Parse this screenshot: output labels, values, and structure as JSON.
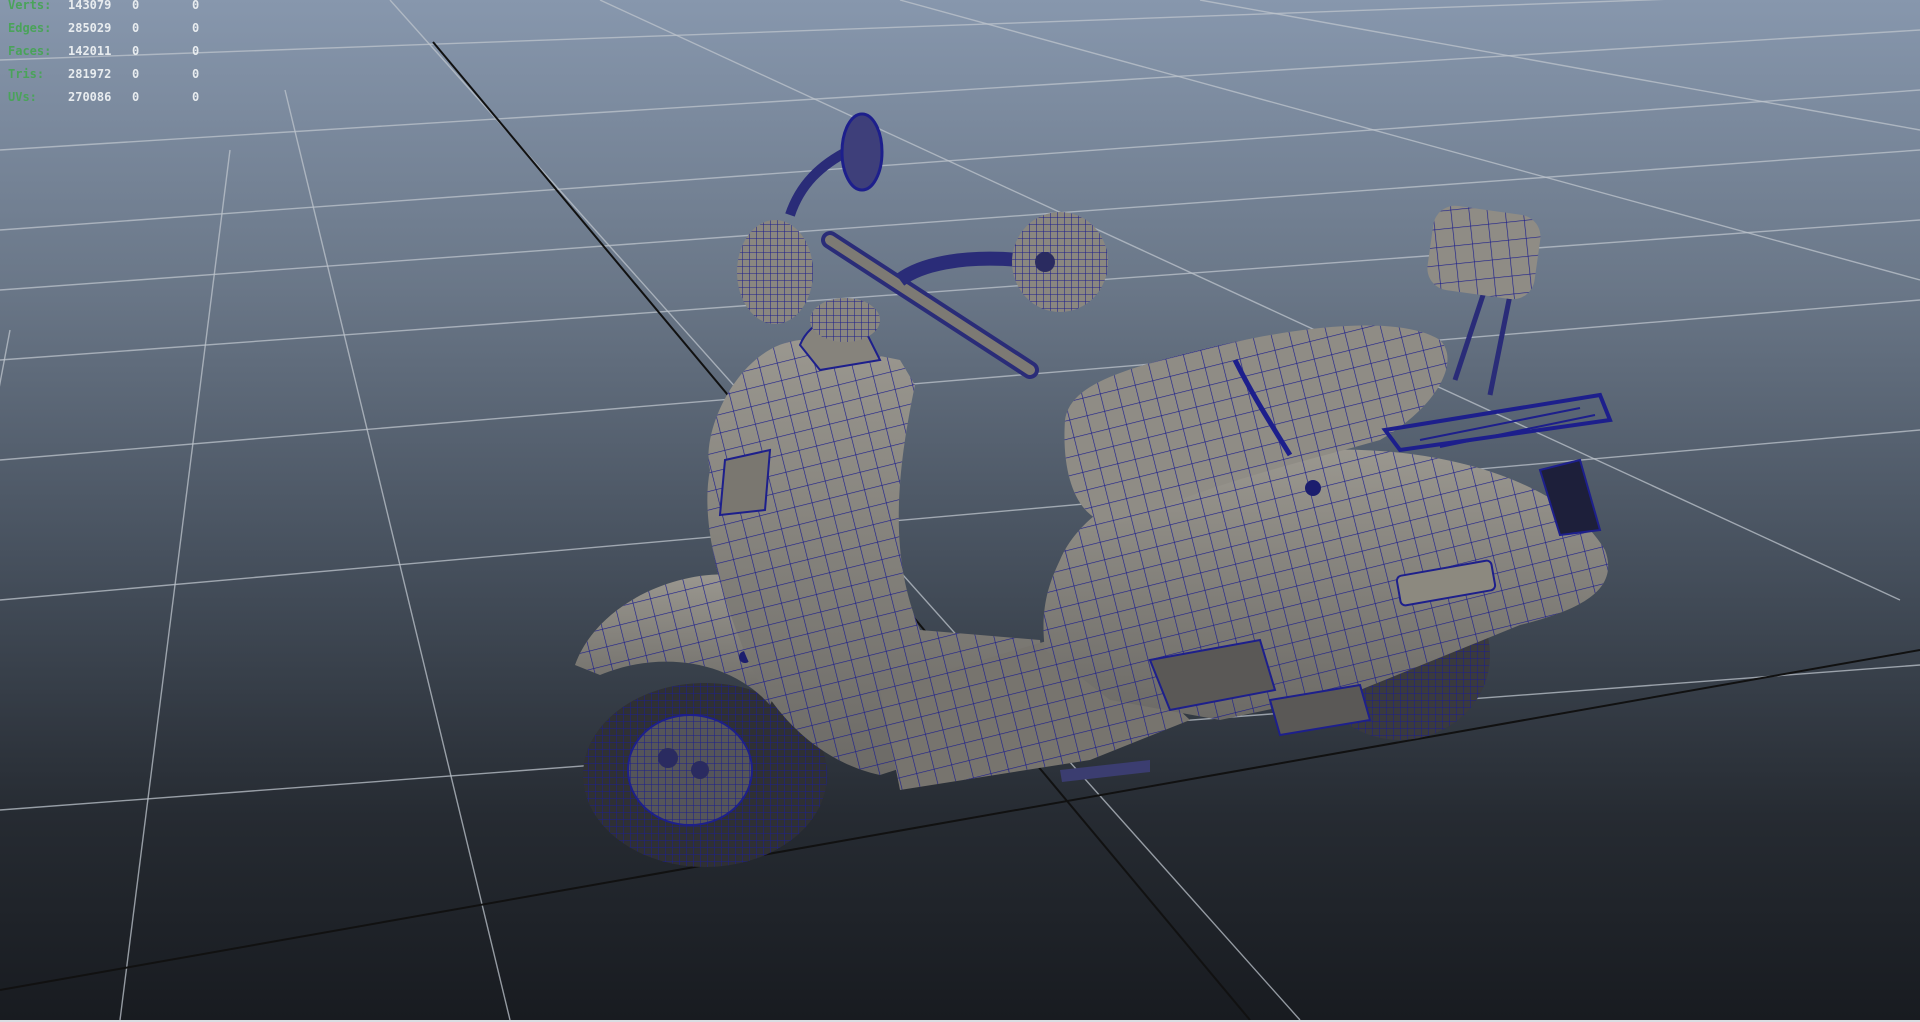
{
  "viewport": {
    "name": "Perspective viewport",
    "heads_up_display": {
      "rows": [
        {
          "label": "Verts:",
          "total": "143079",
          "selected": "0",
          "component": "0"
        },
        {
          "label": "Edges:",
          "total": "285029",
          "selected": "0",
          "component": "0"
        },
        {
          "label": "Faces:",
          "total": "142011",
          "selected": "0",
          "component": "0"
        },
        {
          "label": "Tris:",
          "total": "281972",
          "selected": "0",
          "component": "0"
        },
        {
          "label": "UVs:",
          "total": "270086",
          "selected": "0",
          "component": "0"
        }
      ]
    },
    "scene_object": "scooter wireframe-on-shaded model",
    "colors": {
      "label_green": "#4aa35a",
      "value_white": "#e8ecef",
      "wireframe": "#1d1f8c",
      "shaded_surface": "#8d8a84",
      "grid_line": "#b8bec6",
      "axis_line": "#111111"
    }
  }
}
